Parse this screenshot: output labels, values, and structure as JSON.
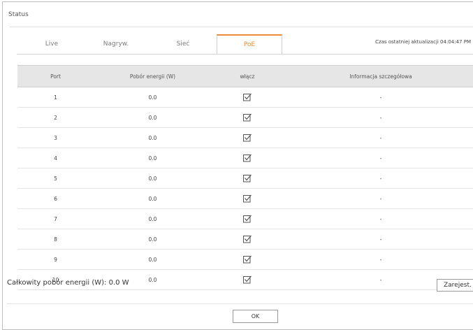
{
  "window": {
    "title": "Status"
  },
  "tabs": [
    {
      "label": "Live"
    },
    {
      "label": "Nagryw."
    },
    {
      "label": "Sieć"
    },
    {
      "label": "PoE"
    }
  ],
  "active_tab": "PoE",
  "last_update": "Czas ostatniej aktualizacji 04:04:47 PM",
  "table": {
    "headers": [
      "Port",
      "Pobór energii (W)",
      "włącz",
      "Informacja szczegółowa"
    ],
    "rows": [
      {
        "port": "1",
        "power": "0.0",
        "enabled": true,
        "info": "-"
      },
      {
        "port": "2",
        "power": "0.0",
        "enabled": true,
        "info": "-"
      },
      {
        "port": "3",
        "power": "0.0",
        "enabled": true,
        "info": "-"
      },
      {
        "port": "4",
        "power": "0.0",
        "enabled": true,
        "info": "-"
      },
      {
        "port": "5",
        "power": "0.0",
        "enabled": true,
        "info": "-"
      },
      {
        "port": "6",
        "power": "0.0",
        "enabled": true,
        "info": "-"
      },
      {
        "port": "7",
        "power": "0.0",
        "enabled": true,
        "info": "-"
      },
      {
        "port": "8",
        "power": "0.0",
        "enabled": true,
        "info": "-"
      },
      {
        "port": "9",
        "power": "0.0",
        "enabled": true,
        "info": "-"
      },
      {
        "port": "10",
        "power": "0.0",
        "enabled": true,
        "info": "-"
      }
    ]
  },
  "footer": {
    "total_label": "Całkowity pobór energii (W): 0.0 W",
    "register_label": "Zarejest.",
    "ok_label": "OK"
  },
  "colors": {
    "accent": "#f08a36",
    "header_bg": "#e6e6e6"
  },
  "icons": {
    "enable_checkbox": "checkbox-checked-icon"
  }
}
